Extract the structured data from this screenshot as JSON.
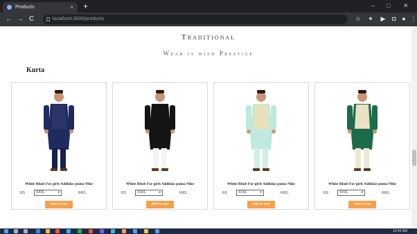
{
  "browser": {
    "tab_title": "Products",
    "tab_close": "×",
    "new_tab": "+",
    "minimize": "–",
    "maximize": "□",
    "close": "✕",
    "back": "←",
    "forward": "→",
    "reload": "C",
    "address": "localhost:3000/products"
  },
  "page": {
    "title": "Traditional",
    "subtitle": "Wear it with Prestige",
    "section": "Kurta"
  },
  "products": [
    {
      "name": "White Rhob For girls Addidas puma Nike",
      "price_label": "RS  ",
      "size": "XXXL",
      "mrp_label": "RRS..",
      "button": "Add to cart",
      "colors": {
        "top": "#1f2a5e",
        "vest": "#2d3566",
        "bottom": "#16214d",
        "skin": "#c99577"
      }
    },
    {
      "name": "White Rhob For girls Addidas puma Nike",
      "price_label": "RS  ",
      "size": "XXXL",
      "mrp_label": "RRS..",
      "button": "Add to cart",
      "colors": {
        "top": "#141414",
        "vest": "#141414",
        "bottom": "#f4f4f4",
        "skin": "#c99577"
      }
    },
    {
      "name": "White Rhob For girls Addidas puma Nike",
      "price_label": "RS  ",
      "size": "XXXL",
      "mrp_label": "RRS..",
      "button": "Add to cart",
      "colors": {
        "top": "#bfe9de",
        "vest": "#e8e1b8",
        "bottom": "#cfeee6",
        "skin": "#c99577"
      }
    },
    {
      "name": "White Rhob For girls Addidas puma Nike",
      "price_label": "RS  ",
      "size": "XXXL",
      "mrp_label": "RRS..",
      "button": "Add to cart",
      "colors": {
        "top": "#1e6b4a",
        "vest": "#e9e1c4",
        "bottom": "#ece6d6",
        "skin": "#c99577"
      }
    }
  ],
  "taskbar": {
    "clock": "10:45 AM"
  },
  "accent": "#f5a04a"
}
